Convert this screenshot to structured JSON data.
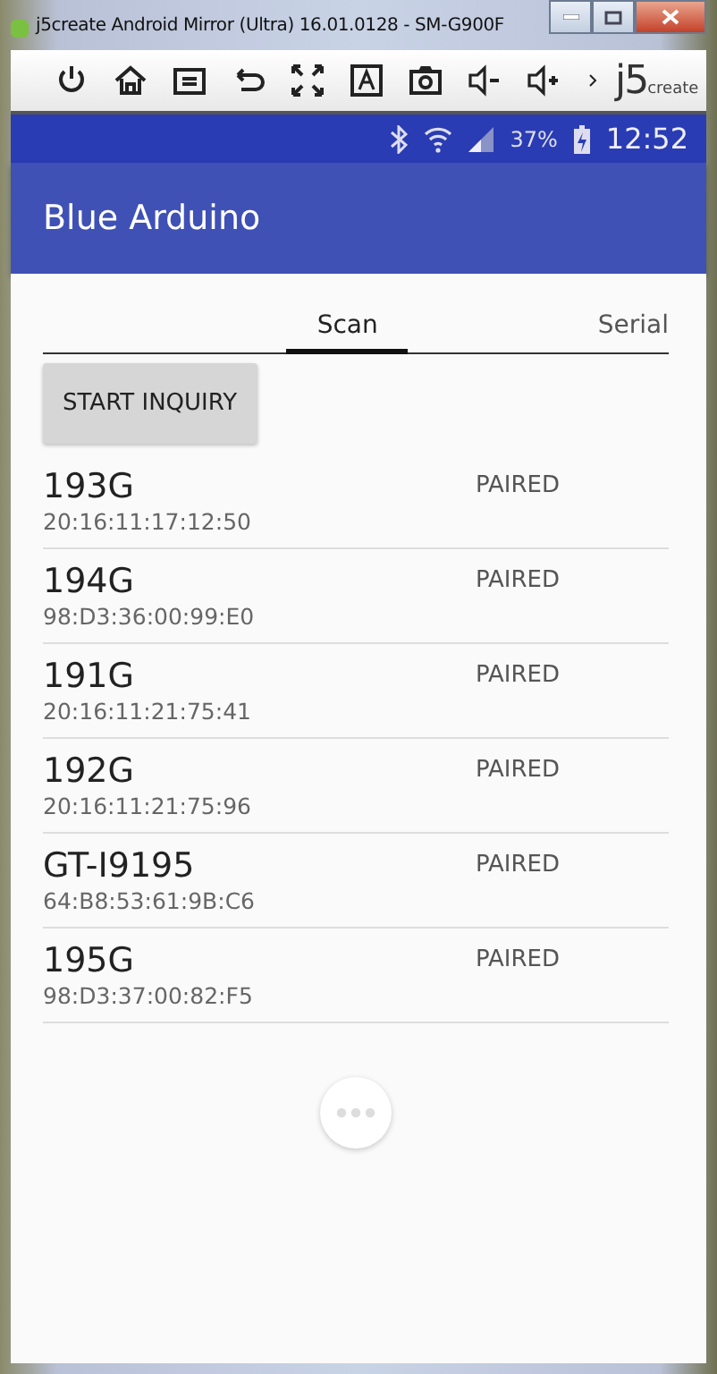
{
  "window": {
    "title": "j5create Android Mirror (Ultra) 16.01.0128 - SM-G900F"
  },
  "toolbar": {
    "logo": "j5",
    "logo_suffix": "create"
  },
  "status_bar": {
    "battery": "37%",
    "time": "12:52"
  },
  "app_bar": {
    "title": "Blue Arduino"
  },
  "tabs": [
    {
      "label": "Scan",
      "selected": true
    },
    {
      "label": "Serial",
      "selected": false
    }
  ],
  "inquiry_button": "START INQUIRY",
  "devices": [
    {
      "name": "193G",
      "address": "20:16:11:17:12:50",
      "status": "PAIRED"
    },
    {
      "name": "194G",
      "address": "98:D3:36:00:99:E0",
      "status": "PAIRED"
    },
    {
      "name": "191G",
      "address": "20:16:11:21:75:41",
      "status": "PAIRED"
    },
    {
      "name": "192G",
      "address": "20:16:11:21:75:96",
      "status": "PAIRED"
    },
    {
      "name": "GT-I9195",
      "address": "64:B8:53:61:9B:C6",
      "status": "PAIRED"
    },
    {
      "name": "195G",
      "address": "98:D3:37:00:82:F5",
      "status": "PAIRED"
    }
  ]
}
